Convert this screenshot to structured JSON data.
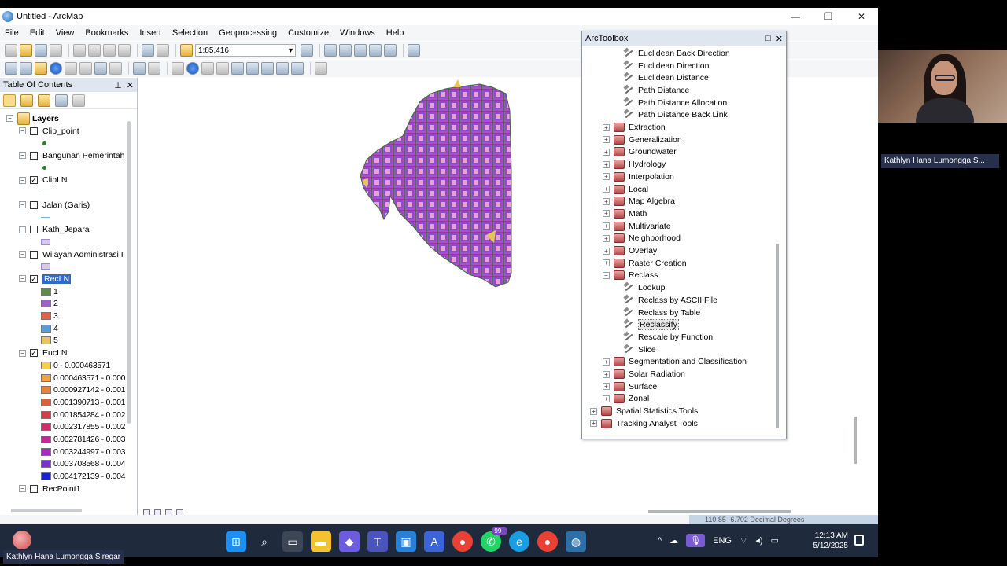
{
  "window": {
    "title": "Untitled - ArcMap",
    "min": "—",
    "max": "❐",
    "close": "✕"
  },
  "menu": [
    "File",
    "Edit",
    "View",
    "Bookmarks",
    "Insert",
    "Selection",
    "Geoprocessing",
    "Customize",
    "Windows",
    "Help"
  ],
  "toolbar": {
    "scale": "1:85,416"
  },
  "toc": {
    "title": "Table Of Contents",
    "pin": "⊥",
    "close": "✕",
    "root": "Layers",
    "layers": [
      {
        "name": "Clip_point",
        "checked": false,
        "symbol": "dot"
      },
      {
        "name": "Bangunan Pemerintah",
        "checked": false,
        "symbol": "dot"
      },
      {
        "name": "ClipLN",
        "checked": true,
        "symbol": "line"
      },
      {
        "name": "Jalan (Garis)",
        "checked": false,
        "symbol": "line"
      },
      {
        "name": "Kath_Jepara",
        "checked": false,
        "symbol": "poly"
      },
      {
        "name": "Wilayah Administrasi I",
        "checked": false,
        "symbol": "poly"
      }
    ],
    "reclass": {
      "name": "RecLN",
      "checked": true,
      "classes": [
        {
          "label": "1",
          "color": "#5f8c4a"
        },
        {
          "label": "2",
          "color": "#a05ec8"
        },
        {
          "label": "3",
          "color": "#e0604f"
        },
        {
          "label": "4",
          "color": "#5a9bdc"
        },
        {
          "label": "5",
          "color": "#e9c45e"
        }
      ]
    },
    "euc": {
      "name": "EucLN",
      "checked": true,
      "classes": [
        {
          "label": "0 - 0.000463571",
          "color": "#f5cf4a"
        },
        {
          "label": "0.000463571 - 0.000",
          "color": "#f0a33e"
        },
        {
          "label": "0.000927142 - 0.001",
          "color": "#e8823a"
        },
        {
          "label": "0.001390713 - 0.001",
          "color": "#de5f38"
        },
        {
          "label": "0.001854284 - 0.002",
          "color": "#d93c48"
        },
        {
          "label": "0.002317855 - 0.002",
          "color": "#d42a6a"
        },
        {
          "label": "0.002781426 - 0.003",
          "color": "#c8279a"
        },
        {
          "label": "0.003244997 - 0.003",
          "color": "#a82ac2"
        },
        {
          "label": "0.003708568 - 0.004",
          "color": "#7a2fd0"
        },
        {
          "label": "0.004172139 - 0.004",
          "color": "#1c1fd8"
        }
      ]
    },
    "last": {
      "name": "RecPoint1",
      "checked": false
    }
  },
  "arctoolbox": {
    "title": "ArcToolbox",
    "float": "□",
    "close": "✕",
    "items": [
      {
        "type": "tool",
        "label": "Euclidean Back Direction",
        "level": 3
      },
      {
        "type": "tool",
        "label": "Euclidean Direction",
        "level": 3
      },
      {
        "type": "tool",
        "label": "Euclidean Distance",
        "level": 3
      },
      {
        "type": "tool",
        "label": "Path Distance",
        "level": 3
      },
      {
        "type": "tool",
        "label": "Path Distance Allocation",
        "level": 3
      },
      {
        "type": "tool",
        "label": "Path Distance Back Link",
        "level": 3
      },
      {
        "type": "toolset",
        "label": "Extraction",
        "level": 2,
        "expander": "+"
      },
      {
        "type": "toolset",
        "label": "Generalization",
        "level": 2,
        "expander": "+"
      },
      {
        "type": "toolset",
        "label": "Groundwater",
        "level": 2,
        "expander": "+"
      },
      {
        "type": "toolset",
        "label": "Hydrology",
        "level": 2,
        "expander": "+"
      },
      {
        "type": "toolset",
        "label": "Interpolation",
        "level": 2,
        "expander": "+"
      },
      {
        "type": "toolset",
        "label": "Local",
        "level": 2,
        "expander": "+"
      },
      {
        "type": "toolset",
        "label": "Map Algebra",
        "level": 2,
        "expander": "+"
      },
      {
        "type": "toolset",
        "label": "Math",
        "level": 2,
        "expander": "+"
      },
      {
        "type": "toolset",
        "label": "Multivariate",
        "level": 2,
        "expander": "+"
      },
      {
        "type": "toolset",
        "label": "Neighborhood",
        "level": 2,
        "expander": "+"
      },
      {
        "type": "toolset",
        "label": "Overlay",
        "level": 2,
        "expander": "+"
      },
      {
        "type": "toolset",
        "label": "Raster Creation",
        "level": 2,
        "expander": "+"
      },
      {
        "type": "toolset",
        "label": "Reclass",
        "level": 2,
        "expander": "−"
      },
      {
        "type": "tool",
        "label": "Lookup",
        "level": 3
      },
      {
        "type": "tool",
        "label": "Reclass by ASCII File",
        "level": 3
      },
      {
        "type": "tool",
        "label": "Reclass by Table",
        "level": 3
      },
      {
        "type": "tool",
        "label": "Reclassify",
        "level": 3,
        "highlight": true
      },
      {
        "type": "tool",
        "label": "Rescale by Function",
        "level": 3
      },
      {
        "type": "tool",
        "label": "Slice",
        "level": 3
      },
      {
        "type": "toolset",
        "label": "Segmentation and Classification",
        "level": 2,
        "expander": "+"
      },
      {
        "type": "toolset",
        "label": "Solar Radiation",
        "level": 2,
        "expander": "+"
      },
      {
        "type": "toolset",
        "label": "Surface",
        "level": 2,
        "expander": "+"
      },
      {
        "type": "toolset",
        "label": "Zonal",
        "level": 2,
        "expander": "+"
      },
      {
        "type": "toolset",
        "label": "Spatial Statistics Tools",
        "level": 1,
        "expander": "+"
      },
      {
        "type": "toolset",
        "label": "Tracking Analyst Tools",
        "level": 1,
        "expander": "+"
      }
    ]
  },
  "status": {
    "coords": "110.85  -6.702 Decimal Degrees"
  },
  "participant": {
    "name_short": "Kathlyn Hana Lumongga S...",
    "name_full": "Kathlyn Hana Lumongga Siregar"
  },
  "taskbar": {
    "chat_badge": "99+",
    "lang": "ENG",
    "time": "12:13 AM",
    "date": "5/12/2025"
  }
}
